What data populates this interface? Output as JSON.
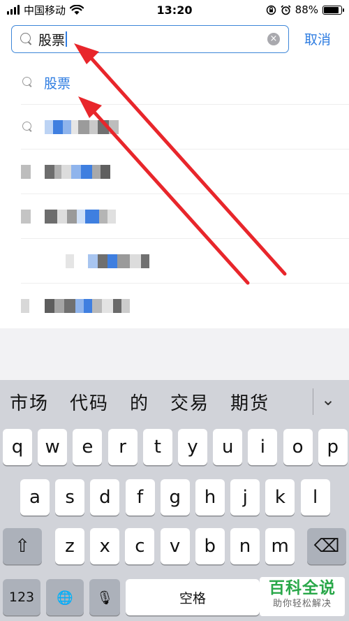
{
  "status": {
    "carrier": "中国移动",
    "time": "13:20",
    "battery": "88%",
    "battery_level": 0.88
  },
  "search": {
    "query": "股票",
    "cancel_label": "取消",
    "clear_symbol": "×"
  },
  "suggestions": [
    {
      "text": "股票"
    }
  ],
  "keyboard": {
    "candidates": [
      "市场",
      "代码",
      "的",
      "交易",
      "期货"
    ],
    "expand_symbol": "⌄",
    "row1": [
      "q",
      "w",
      "e",
      "r",
      "t",
      "y",
      "u",
      "i",
      "o",
      "p"
    ],
    "row2": [
      "a",
      "s",
      "d",
      "f",
      "g",
      "h",
      "j",
      "k",
      "l"
    ],
    "row3": [
      "z",
      "x",
      "c",
      "v",
      "b",
      "n",
      "m"
    ],
    "shift_symbol": "⇧",
    "delete_symbol": "⌫",
    "numbers_label": "123",
    "globe_symbol": "🌐",
    "mic_symbol": "🎙",
    "space_label": "空格"
  },
  "watermark": {
    "title": "百科全说",
    "subtitle": "助你轻松解决"
  },
  "colors": {
    "accent": "#2f7de1",
    "arrow": "#e8262b",
    "keyboard_bg": "#d1d3d9",
    "watermark_green": "#2aa84a"
  }
}
